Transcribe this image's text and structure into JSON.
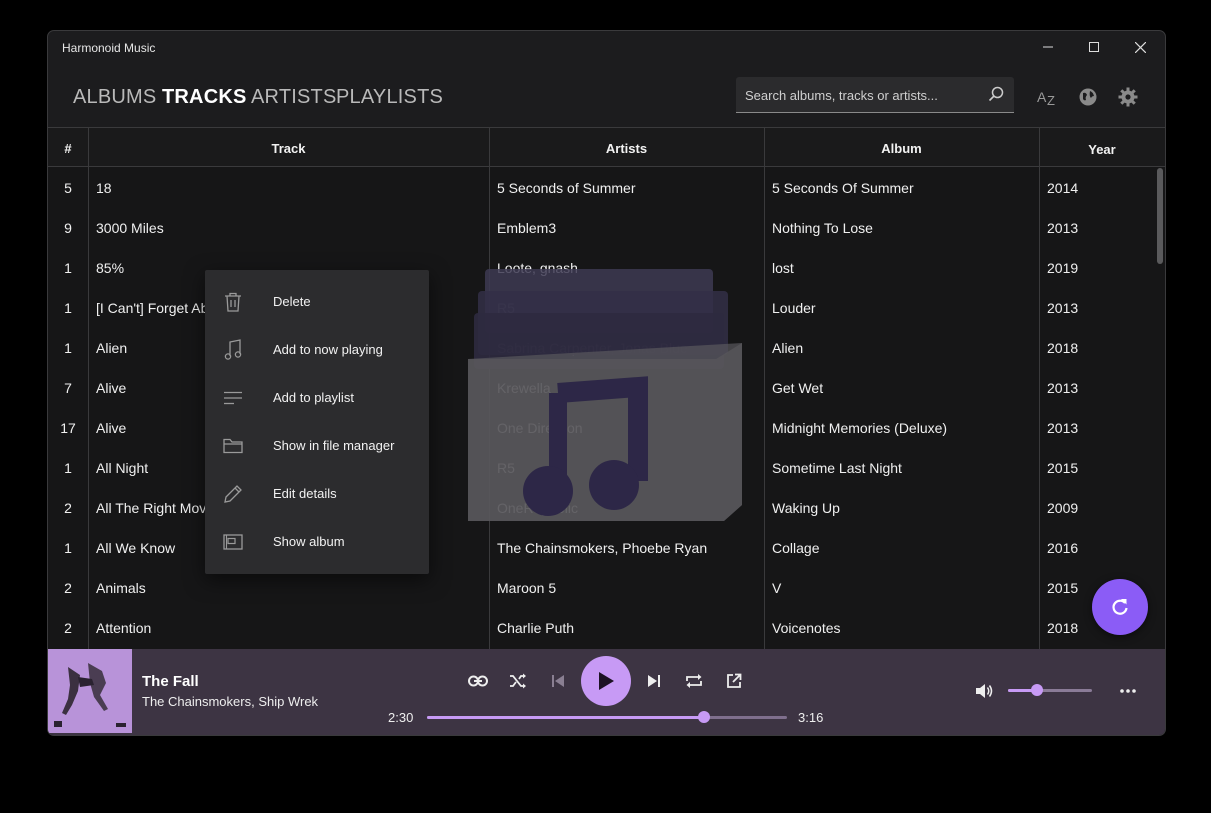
{
  "window": {
    "title": "Harmonoid Music"
  },
  "tabs": [
    {
      "label": "ALBUMS",
      "active": false
    },
    {
      "label": "TRACKS",
      "active": true
    },
    {
      "label": "ARTISTS",
      "active": false
    },
    {
      "label": "PLAYLISTS",
      "active": false
    }
  ],
  "search": {
    "placeholder": "Search albums, tracks or artists...",
    "value": ""
  },
  "toolbar_icons": [
    "sort-az-icon",
    "globe-icon",
    "settings-gear-icon"
  ],
  "table": {
    "headers": {
      "number": "#",
      "track": "Track",
      "artists": "Artists",
      "album": "Album",
      "year": "Year"
    },
    "rows": [
      {
        "number": "5",
        "track": "18",
        "artists": "5 Seconds of Summer",
        "album": "5 Seconds Of Summer",
        "year": "2014"
      },
      {
        "number": "9",
        "track": "3000 Miles",
        "artists": "Emblem3",
        "album": "Nothing To Lose",
        "year": "2013"
      },
      {
        "number": "1",
        "track": "85%",
        "artists": "Loote, gnash",
        "album": "lost",
        "year": "2019"
      },
      {
        "number": "1",
        "track": "[I Can't] Forget About You",
        "artists": "R5",
        "album": "Louder",
        "year": "2013"
      },
      {
        "number": "1",
        "track": "Alien",
        "artists": "Sabrina Carpenter, Jonas Blue",
        "album": "Alien",
        "year": "2018"
      },
      {
        "number": "7",
        "track": "Alive",
        "artists": "Krewella",
        "album": "Get Wet",
        "year": "2013"
      },
      {
        "number": "17",
        "track": "Alive",
        "artists": "One Direction",
        "album": "Midnight Memories (Deluxe)",
        "year": "2013"
      },
      {
        "number": "1",
        "track": "All Night",
        "artists": "R5",
        "album": "Sometime Last Night",
        "year": "2015"
      },
      {
        "number": "2",
        "track": "All The Right Moves",
        "artists": "OneRepublic",
        "album": "Waking Up",
        "year": "2009"
      },
      {
        "number": "1",
        "track": "All We Know",
        "artists": "The Chainsmokers, Phoebe Ryan",
        "album": "Collage",
        "year": "2016"
      },
      {
        "number": "2",
        "track": "Animals",
        "artists": "Maroon 5",
        "album": "V",
        "year": "2015"
      },
      {
        "number": "2",
        "track": "Attention",
        "artists": "Charlie Puth",
        "album": "Voicenotes",
        "year": "2018"
      },
      {
        "number": "",
        "track": "",
        "artists": "",
        "album": "",
        "year": ""
      }
    ]
  },
  "context_menu": {
    "items": [
      {
        "label": "Delete",
        "icon": "trash-icon"
      },
      {
        "label": "Add to now playing",
        "icon": "music-note-icon"
      },
      {
        "label": "Add to playlist",
        "icon": "playlist-add-icon"
      },
      {
        "label": "Show in file manager",
        "icon": "folder-icon"
      },
      {
        "label": "Edit details",
        "icon": "pencil-icon"
      },
      {
        "label": "Show album",
        "icon": "album-icon"
      }
    ]
  },
  "player": {
    "title": "The Fall",
    "artist": "The Chainsmokers, Ship Wrek",
    "current_time": "2:30",
    "total_time": "3:16",
    "progress": 0.77,
    "volume": 0.35
  },
  "colors": {
    "accent": "#8b5cf6",
    "player_bg": "#3d3443",
    "play_button": "#c79af5",
    "background": "#1c1c1e"
  }
}
